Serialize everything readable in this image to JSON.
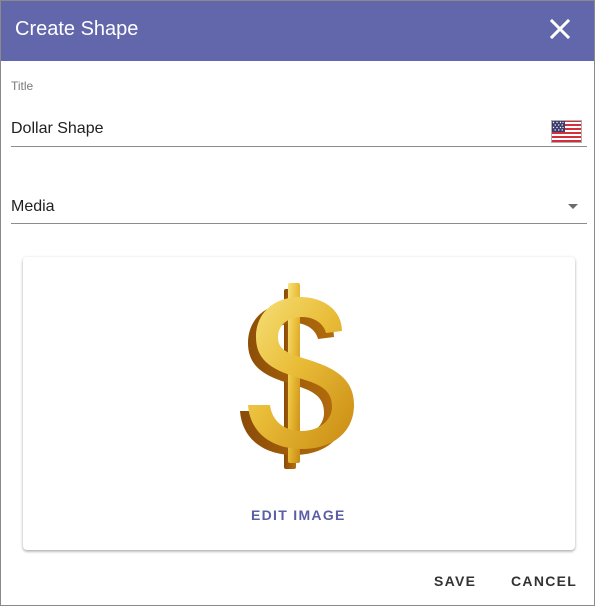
{
  "dialog": {
    "title": "Create Shape",
    "close_icon": "close-icon"
  },
  "title_field": {
    "label": "Title",
    "value": "Dollar Shape",
    "language_icon": "us-flag-icon"
  },
  "media_field": {
    "selected": "Media",
    "dropdown_icon": "dropdown-arrow-icon"
  },
  "preview": {
    "image_icon": "dollar-sign-image",
    "edit_label": "EDIT IMAGE"
  },
  "actions": {
    "save_label": "SAVE",
    "cancel_label": "CANCEL"
  },
  "colors": {
    "header": "#6266ab",
    "accent": "#5b5ea6",
    "gold": "#e0a82e"
  }
}
